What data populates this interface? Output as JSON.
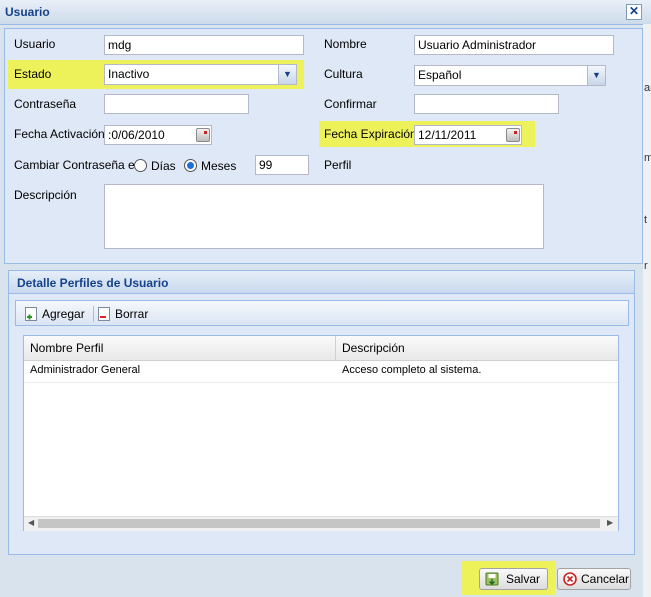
{
  "window": {
    "title": "Usuario",
    "close_glyph": "✕",
    "edge_fragments": [
      "an",
      "m",
      "t",
      "r"
    ]
  },
  "form": {
    "usuario": {
      "label": "Usuario",
      "value": "mdg"
    },
    "nombre": {
      "label": "Nombre",
      "value": "Usuario Administrador"
    },
    "estado": {
      "label": "Estado",
      "value": "Inactivo"
    },
    "cultura": {
      "label": "Cultura",
      "value": "Español"
    },
    "contrasena": {
      "label": "Contraseña",
      "value": ""
    },
    "confirmar": {
      "label": "Confirmar",
      "value": ""
    },
    "fecha_activacion": {
      "label": "Fecha Activación",
      "value": ":0/06/2010"
    },
    "fecha_expiracion": {
      "label": "Fecha Expiración",
      "value": "12/11/2011"
    },
    "cambiar": {
      "label": "Cambiar Contraseña en",
      "option_dias": "Días",
      "option_meses": "Meses",
      "selected": "Meses",
      "value": "99"
    },
    "perfil": {
      "label": "Perfil"
    },
    "descripcion": {
      "label": "Descripción",
      "value": ""
    }
  },
  "perfiles": {
    "title": "Detalle Perfiles de Usuario",
    "toolbar": {
      "agregar": "Agregar",
      "borrar": "Borrar"
    },
    "columns": [
      "Nombre Perfil",
      "Descripción"
    ],
    "rows": [
      {
        "nombre": "Administrador General",
        "descripcion": "Acceso completo al sistema."
      }
    ]
  },
  "footer": {
    "salvar": "Salvar",
    "cancelar": "Cancelar"
  },
  "icons": {
    "close": "close-icon",
    "dropdown": "chevron-down-icon",
    "calendar": "calendar-icon",
    "add": "add-document-icon",
    "delete": "delete-document-icon",
    "save": "save-icon",
    "cancel": "cancel-icon",
    "scroll_left": "arrow-left-icon",
    "scroll_right": "arrow-right-icon"
  },
  "colors": {
    "highlight": "#eef25a",
    "title_text": "#15428b",
    "panel_bg": "#dfe8f6",
    "border": "#99bbe8"
  }
}
